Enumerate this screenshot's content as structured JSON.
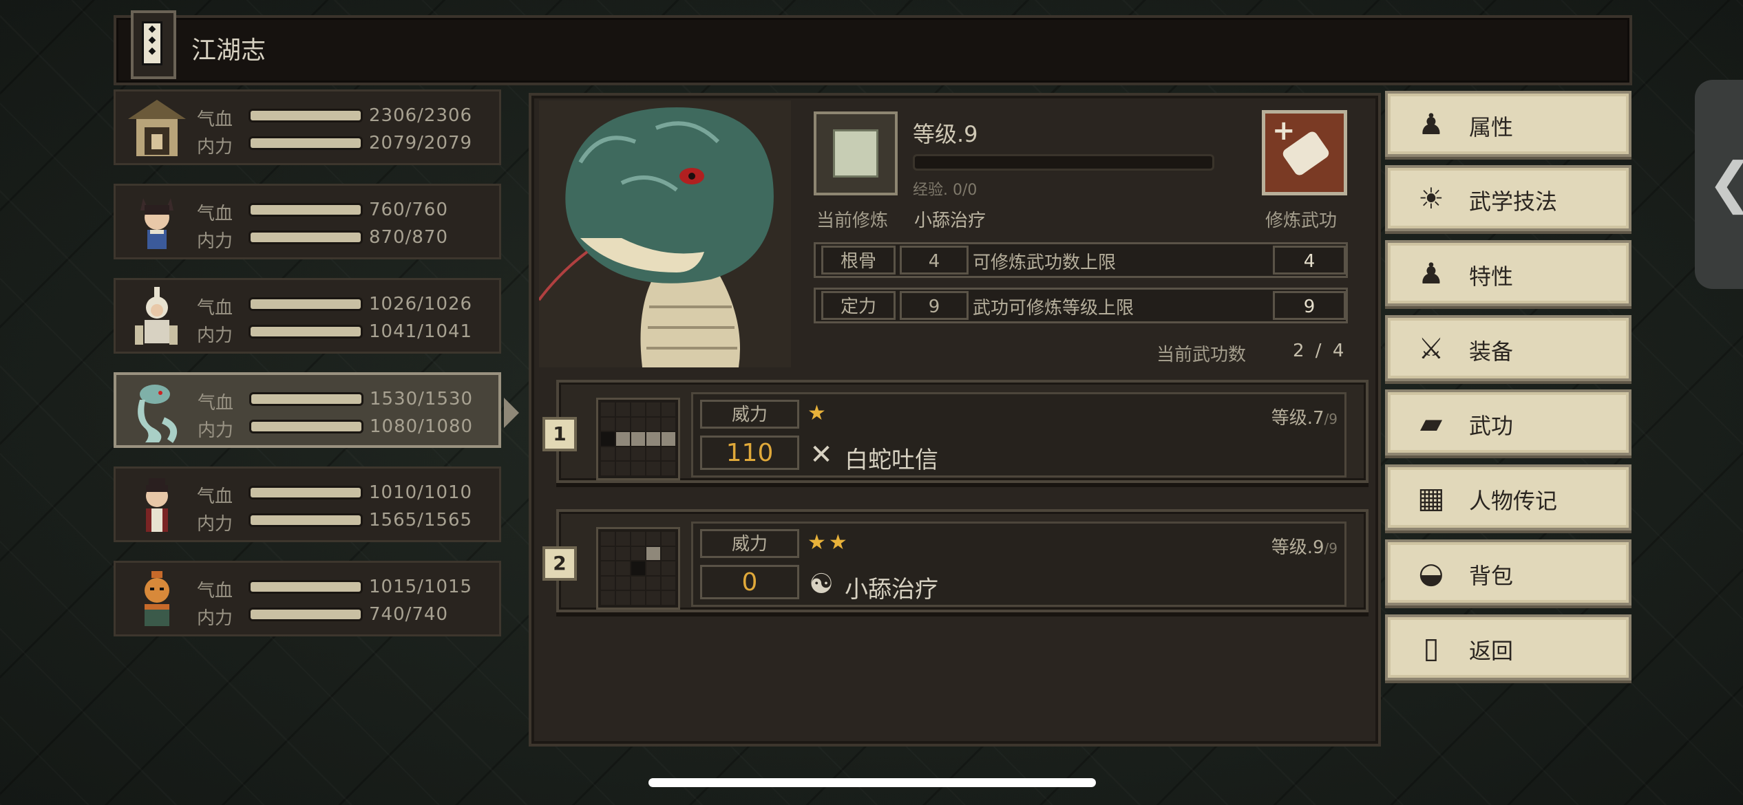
{
  "header": {
    "title": "江湖志"
  },
  "roster": [
    {
      "hp_label": "气血",
      "hp": "2306/2306",
      "mp_label": "内力",
      "mp": "2079/2079"
    },
    {
      "hp_label": "气血",
      "hp": "760/760",
      "mp_label": "内力",
      "mp": "870/870"
    },
    {
      "hp_label": "气血",
      "hp": "1026/1026",
      "mp_label": "内力",
      "mp": "1041/1041"
    },
    {
      "hp_label": "气血",
      "hp": "1530/1530",
      "mp_label": "内力",
      "mp": "1080/1080"
    },
    {
      "hp_label": "气血",
      "hp": "1010/1010",
      "mp_label": "内力",
      "mp": "1565/1565"
    },
    {
      "hp_label": "气血",
      "hp": "1015/1015",
      "mp_label": "内力",
      "mp": "740/740"
    }
  ],
  "selected_index": 3,
  "detail": {
    "level_label": "等级.9",
    "exp_text": "经验. 0/0",
    "exp_progress": 0,
    "current_training_label": "当前修炼",
    "current_training_value": "小舔治疗",
    "train_button_label": "修炼武功",
    "attributes": [
      {
        "name": "根骨",
        "value": "4",
        "desc": "可修炼武功数上限",
        "limit": "4"
      },
      {
        "name": "定力",
        "value": "9",
        "desc": "武功可修炼等级上限",
        "limit": "9"
      }
    ],
    "skill_count_label": "当前武功数",
    "skill_count_value": "2 / 4"
  },
  "skills": [
    {
      "num": "1",
      "power_label": "威力",
      "power": "110",
      "stars": "★",
      "type_icon": "crossed-swords-icon",
      "type_glyph": "✕",
      "name": "白蛇吐信",
      "level": "等级.7",
      "level_max": "/9"
    },
    {
      "num": "2",
      "power_label": "威力",
      "power": "0",
      "stars": "★★",
      "type_icon": "yin-yang-icon",
      "type_glyph": "☯",
      "name": "小舔治疗",
      "level": "等级.9",
      "level_max": "/9"
    }
  ],
  "menu": [
    {
      "label": "属性",
      "icon": "figure-icon",
      "glyph": "♟"
    },
    {
      "label": "武学技法",
      "icon": "radiant-figure-icon",
      "glyph": "☀"
    },
    {
      "label": "特性",
      "icon": "meditating-figure-icon",
      "glyph": "♟"
    },
    {
      "label": "装备",
      "icon": "sword-icon",
      "glyph": "⚔"
    },
    {
      "label": "武功",
      "icon": "manual-icon",
      "glyph": "▰"
    },
    {
      "label": "人物传记",
      "icon": "scroll-icon",
      "glyph": "▦"
    },
    {
      "label": "背包",
      "icon": "bag-icon",
      "glyph": "◒"
    },
    {
      "label": "返回",
      "icon": "door-icon",
      "glyph": "▯"
    }
  ],
  "side_tab": {
    "glyph": "❮"
  },
  "colors": {
    "accent_gold": "#e0a93a",
    "menu_bg": "#e1d8ba",
    "panel_bg": "#2a2520"
  }
}
